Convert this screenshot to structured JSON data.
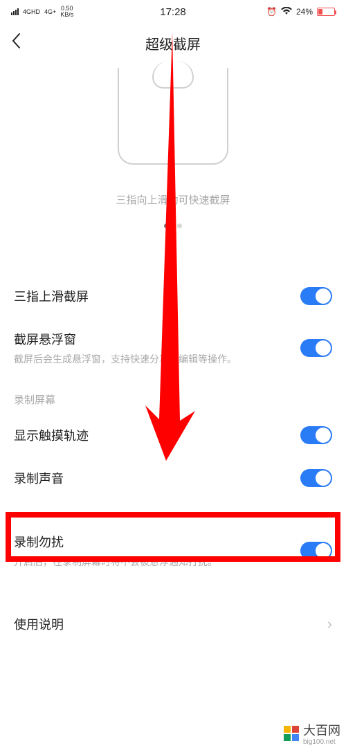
{
  "status": {
    "net1": "4GHD",
    "net2": "4G+",
    "speed_value": "0.50",
    "speed_unit": "KB/s",
    "time": "17:28",
    "battery_pct": "24%"
  },
  "nav": {
    "title": "超级截屏"
  },
  "illustration": {
    "caption": "三指向上滑动可快速截屏"
  },
  "settings": {
    "swipe": {
      "label": "三指上滑截屏",
      "on": true
    },
    "floating": {
      "label": "截屏悬浮窗",
      "desc": "截屏后会生成悬浮窗，支持快速分享、编辑等操作。",
      "on": true
    }
  },
  "record_section": {
    "header": "录制屏幕",
    "touch": {
      "label": "显示触摸轨迹",
      "on": true
    },
    "sound": {
      "label": "录制声音",
      "on": true
    },
    "dnd": {
      "label": "录制勿扰",
      "desc": "开启后，在录制屏幕时将不会被悬浮通知打扰。",
      "on": true
    }
  },
  "help": {
    "label": "使用说明"
  },
  "watermark": {
    "brand": "大百网",
    "domain": "big100.net"
  }
}
